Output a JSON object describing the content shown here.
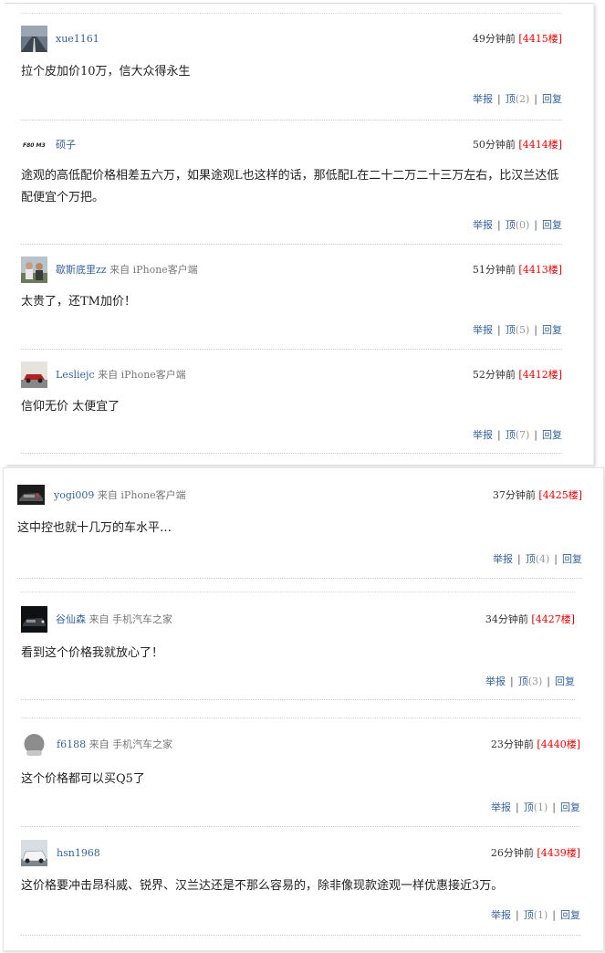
{
  "comments": [
    {
      "username": "xue1161",
      "from": "",
      "time": "49分钟前",
      "floor": "4415楼",
      "content": "拉个皮加价10万，信大众得永生",
      "report": "举报",
      "like": "顶",
      "like_count": "(2)",
      "reply": "回复",
      "avatar": "road"
    },
    {
      "username": "硕子",
      "from": "",
      "time": "50分钟前",
      "floor": "4414楼",
      "content": "途观的高低配价格相差五六万，如果途观L也这样的话，那低配L在二十二万二十三万左右，比汉兰达低配便宜个万把。",
      "report": "举报",
      "like": "顶",
      "like_count": "(0)",
      "reply": "回复",
      "avatar": "text",
      "avatar_text": "F80 M3"
    },
    {
      "username": "歇斯底里zz",
      "from": "来自 iPhone客户端",
      "time": "51分钟前",
      "floor": "4413楼",
      "content": "太贵了，还TM加价！",
      "report": "举报",
      "like": "顶",
      "like_count": "(5)",
      "reply": "回复",
      "avatar": "people"
    },
    {
      "username": "Lesliejc",
      "from": "来自 iPhone客户端",
      "time": "52分钟前",
      "floor": "4412楼",
      "content": "信仰无价 太便宜了",
      "report": "举报",
      "like": "顶",
      "like_count": "(7)",
      "reply": "回复",
      "avatar": "car-red"
    },
    {
      "username": "yogi009",
      "from": "来自 iPhone客户端",
      "time": "37分钟前",
      "floor": "4425楼",
      "content": "这中控也就十几万的车水平…",
      "report": "举报",
      "like": "顶",
      "like_count": "(4)",
      "reply": "回复",
      "avatar": "car-dark"
    },
    {
      "username": "谷仙森",
      "from": "来自 手机汽车之家",
      "time": "34分钟前",
      "floor": "4427楼",
      "content": "看到这个价格我就放心了！",
      "report": "举报",
      "like": "顶",
      "like_count": "(3)",
      "reply": "回复",
      "avatar": "car-night"
    },
    {
      "username": "f6188",
      "from": "来自 手机汽车之家",
      "time": "23分钟前",
      "floor": "4440楼",
      "content": "这个价格都可以买Q5了",
      "report": "举报",
      "like": "顶",
      "like_count": "(1)",
      "reply": "回复",
      "avatar": "default"
    },
    {
      "username": "hsn1968",
      "from": "",
      "time": "26分钟前",
      "floor": "4439楼",
      "content": "这价格要冲击昂科威、锐界、汉兰达还是不那么容易的，除非像现款途观一样优惠接近3万。",
      "report": "举报",
      "like": "顶",
      "like_count": "(1)",
      "reply": "回复",
      "avatar": "car-white"
    }
  ]
}
